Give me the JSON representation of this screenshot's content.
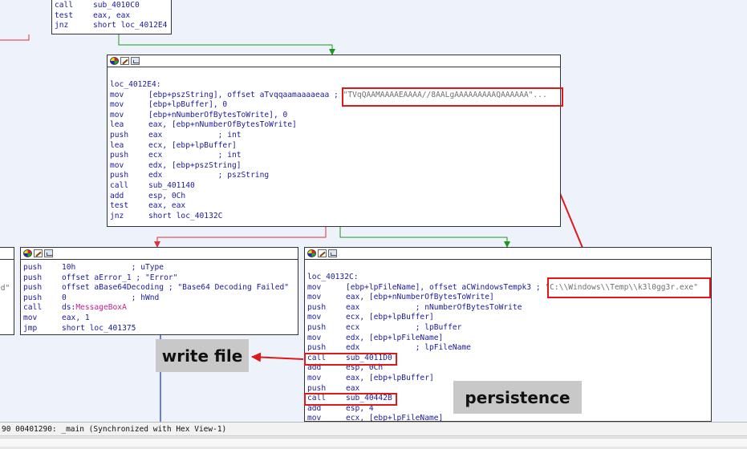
{
  "top_node": {
    "lines": [
      {
        "mn": "call",
        "op": "sub_4010C0"
      },
      {
        "mn": "test",
        "op": "eax, eax"
      },
      {
        "mn": "jnz",
        "op": "short loc_4012E4"
      }
    ]
  },
  "main_node": {
    "label": "loc_4012E4:",
    "line0_mn": "mov",
    "line0_op": "[ebp+pszString], offset aTvqqaamaaaaeaa",
    "line0_sep": " ; ",
    "line0_str": "\"TVqQAAMAAAAEAAAA//8AALgAAAAAAAAAQAAAAAA\"...",
    "lines": [
      {
        "mn": "mov",
        "op": "[ebp+lpBuffer], 0",
        "cmt": ""
      },
      {
        "mn": "mov",
        "op": "[ebp+nNumberOfBytesToWrite], 0",
        "cmt": ""
      },
      {
        "mn": "lea",
        "op": "eax, [ebp+nNumberOfBytesToWrite]",
        "cmt": ""
      },
      {
        "mn": "push",
        "op": "eax            ",
        "cmt": "; int"
      },
      {
        "mn": "lea",
        "op": "ecx, [ebp+lpBuffer]",
        "cmt": ""
      },
      {
        "mn": "push",
        "op": "ecx            ",
        "cmt": "; int"
      },
      {
        "mn": "mov",
        "op": "edx, [ebp+pszString]",
        "cmt": ""
      },
      {
        "mn": "push",
        "op": "edx            ",
        "cmt": "; pszString"
      },
      {
        "mn": "call",
        "op": "sub_401140",
        "cmt": ""
      },
      {
        "mn": "add",
        "op": "esp, 0Ch",
        "cmt": ""
      },
      {
        "mn": "test",
        "op": "eax, eax",
        "cmt": ""
      },
      {
        "mn": "jnz",
        "op": "short loc_40132C",
        "cmt": ""
      }
    ]
  },
  "left_partial_text": "ed\"",
  "error_node": {
    "lines": [
      {
        "mn": "push",
        "op": "10h            ",
        "cmt": "; uType"
      },
      {
        "mn": "push",
        "op": "offset aError_1 ",
        "cmt": "; \"Error\""
      },
      {
        "mn": "push",
        "op": "offset aBase64Decoding ",
        "cmt": "; \"Base64 Decoding Failed\""
      },
      {
        "mn": "push",
        "op": "0              ",
        "cmt": "; hWnd"
      }
    ],
    "call_mn": "call",
    "call_prefix": "ds:",
    "call_fn": "MessageBoxA",
    "tail": [
      {
        "mn": "mov",
        "op": "eax, 1"
      },
      {
        "mn": "jmp",
        "op": "short loc_401375"
      }
    ]
  },
  "loc_node": {
    "label": "loc_40132C:",
    "line0_mn": "mov",
    "line0_op": "[ebp+lpFileName], offset aCWindowsTempk3",
    "line0_sep": " ; ",
    "line0_str": "\"C:\\\\Windows\\\\Temp\\\\k3l0gg3r.exe\"",
    "lines": [
      {
        "mn": "mov",
        "op": "eax, [ebp+nNumberOfBytesToWrite]",
        "cmt": ""
      },
      {
        "mn": "push",
        "op": "eax            ",
        "cmt": "; nNumberOfBytesToWrite"
      },
      {
        "mn": "mov",
        "op": "ecx, [ebp+lpBuffer]",
        "cmt": ""
      },
      {
        "mn": "push",
        "op": "ecx            ",
        "cmt": "; lpBuffer"
      },
      {
        "mn": "mov",
        "op": "edx, [ebp+lpFileName]",
        "cmt": ""
      },
      {
        "mn": "push",
        "op": "edx            ",
        "cmt": "; lpFileName"
      },
      {
        "mn": "call",
        "op": "sub_4011D0",
        "cmt": ""
      },
      {
        "mn": "add",
        "op": "esp, 0Ch",
        "cmt": ""
      },
      {
        "mn": "mov",
        "op": "eax, [ebp+lpBuffer]",
        "cmt": ""
      },
      {
        "mn": "push",
        "op": "eax",
        "cmt": ""
      },
      {
        "mn": "call",
        "op": "sub_40442B",
        "cmt": ""
      },
      {
        "mn": "add",
        "op": "esp, 4",
        "cmt": ""
      },
      {
        "mn": "mov",
        "op": "ecx, [ebp+lpFileName]",
        "cmt": ""
      }
    ]
  },
  "callouts": {
    "write_file": "write file",
    "persistence": "persistence"
  },
  "status_bar": "90 00401290: _main (Synchronized with Hex View-1)",
  "colors": {
    "highlight": "#e01818",
    "edge_true": "#1a9a1a",
    "edge_false": "#e03030",
    "edge_uncond": "#3a5ad0",
    "callout_bg": "#c8c8c8",
    "canvas_bg": "#eef2fb"
  },
  "icons": [
    "color-palette-icon",
    "edit-node-icon",
    "graph-view-icon"
  ]
}
